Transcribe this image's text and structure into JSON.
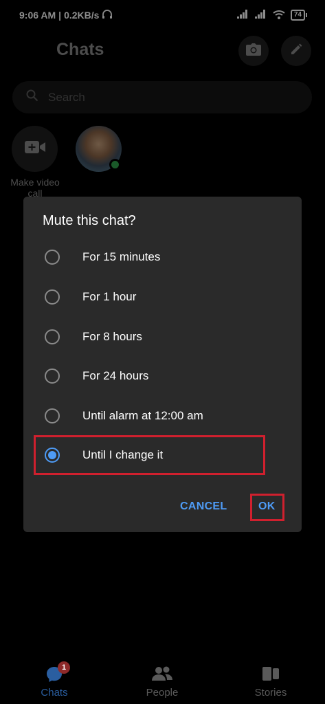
{
  "status_bar": {
    "time": "9:06 AM",
    "network_speed": "0.2KB/s",
    "battery_level": "74",
    "icons": [
      "headset-icon",
      "signal-icon",
      "signal-icon",
      "wifi-icon",
      "battery-icon"
    ]
  },
  "header": {
    "title": "Chats",
    "camera_icon": "camera-icon",
    "compose_icon": "pencil-icon"
  },
  "search": {
    "placeholder": "Search"
  },
  "stories_row": {
    "video_call_label": "Make video call",
    "online_status_color": "#31a24c"
  },
  "dialog": {
    "title": "Mute this chat?",
    "options": [
      {
        "label": "For 15 minutes",
        "selected": false
      },
      {
        "label": "For 1 hour",
        "selected": false
      },
      {
        "label": "For 8 hours",
        "selected": false
      },
      {
        "label": "For 24 hours",
        "selected": false
      },
      {
        "label": "Until alarm at 12:00 am",
        "selected": false
      },
      {
        "label": "Until I change it",
        "selected": true
      }
    ],
    "cancel_label": "CANCEL",
    "ok_label": "OK",
    "accent_color": "#4e9bf5",
    "highlight_color": "#d0202e"
  },
  "bottom_nav": {
    "items": [
      {
        "label": "Chats",
        "icon": "chat-bubble-icon",
        "badge": "1",
        "active": true
      },
      {
        "label": "People",
        "icon": "people-icon",
        "active": false
      },
      {
        "label": "Stories",
        "icon": "stories-icon",
        "active": false
      }
    ]
  }
}
